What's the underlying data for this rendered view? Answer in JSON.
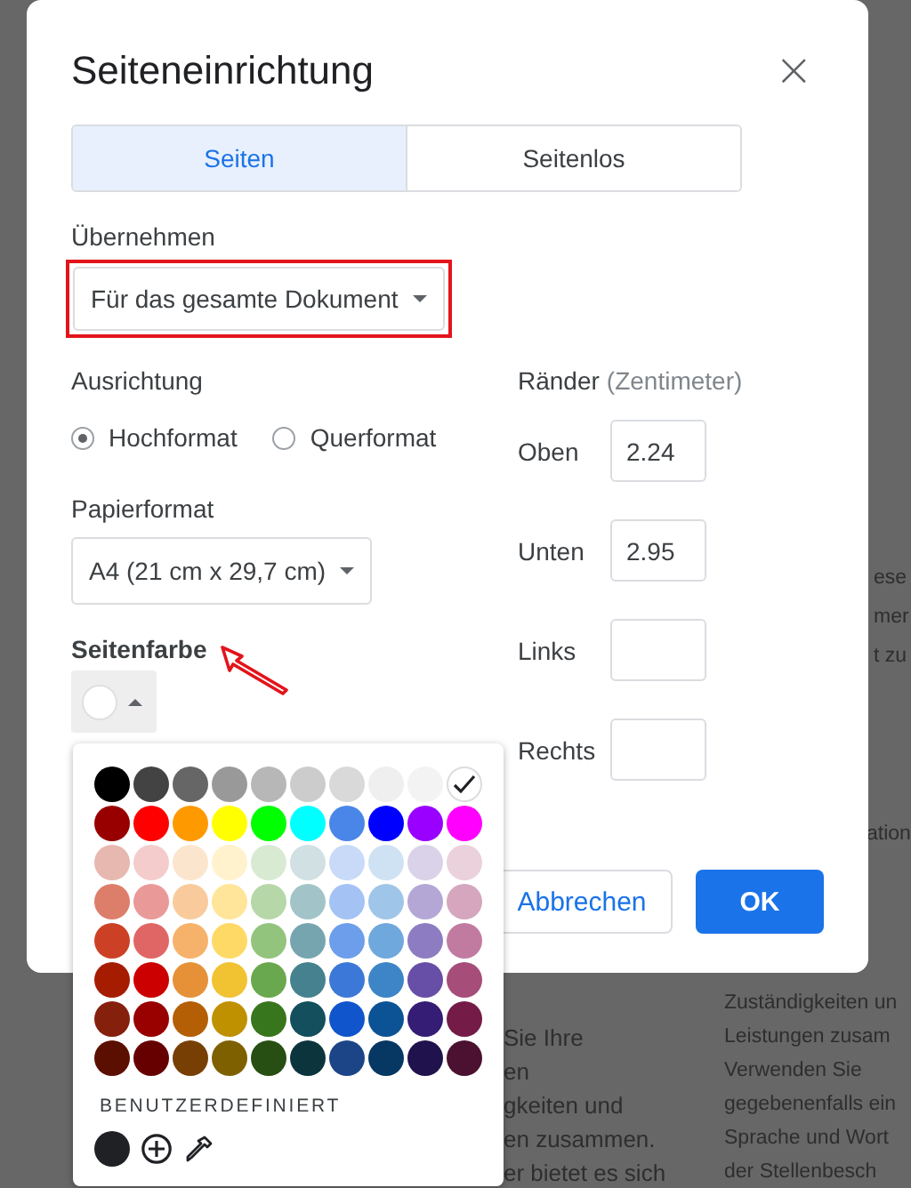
{
  "background_document": {
    "right_column": [
      "ese",
      "mer",
      "t zu",
      "ation",
      "Zuständigkeiten un",
      "Leistungen zusam",
      "Verwenden Sie",
      "gegebenenfalls ein",
      "Sprache und Wort",
      "der Stellenbesch"
    ],
    "middle_column": [
      "Sie Ihre",
      "en",
      "gkeiten und",
      "en zusammen.",
      "er bietet es sich"
    ]
  },
  "dialog": {
    "title": "Seiteneinrichtung",
    "close": "×",
    "tabs": [
      {
        "label": "Seiten",
        "selected": true
      },
      {
        "label": "Seitenlos",
        "selected": false
      }
    ],
    "apply": {
      "label": "Übernehmen",
      "value": "Für das gesamte Dokument"
    },
    "orientation": {
      "label": "Ausrichtung",
      "options": [
        {
          "label": "Hochformat",
          "selected": true
        },
        {
          "label": "Querformat",
          "selected": false
        }
      ]
    },
    "paper_size": {
      "label": "Papierformat",
      "value": "A4 (21 cm x 29,7 cm)"
    },
    "page_color": {
      "label": "Seitenfarbe",
      "color": "#ffffff"
    },
    "margins": {
      "label": "Ränder",
      "unit": "(Zentimeter)",
      "fields": [
        {
          "label": "Oben",
          "value": "2.24"
        },
        {
          "label": "Unten",
          "value": "2.95"
        },
        {
          "label": "Links"
        },
        {
          "label": "Rechts"
        }
      ]
    },
    "buttons": [
      {
        "label": "Abbrechen",
        "kind": "secondary"
      },
      {
        "label": "OK",
        "kind": "primary"
      }
    ]
  },
  "palette": {
    "swatches": [
      {
        "color": "#000000",
        "selected": false
      },
      {
        "color": "#434343",
        "selected": false
      },
      {
        "color": "#666666",
        "selected": false
      },
      {
        "color": "#999999",
        "selected": false
      },
      {
        "color": "#b7b7b7",
        "selected": false
      },
      {
        "color": "#cccccc",
        "selected": false
      },
      {
        "color": "#d9d9d9",
        "selected": false
      },
      {
        "color": "#efefef",
        "selected": false
      },
      {
        "color": "#f3f3f3",
        "selected": false
      },
      {
        "color": "#ffffff",
        "selected": true
      },
      {
        "color": "#980000",
        "selected": false
      },
      {
        "color": "#ff0000",
        "selected": false
      },
      {
        "color": "#ff9900",
        "selected": false
      },
      {
        "color": "#ffff00",
        "selected": false
      },
      {
        "color": "#00ff00",
        "selected": false
      },
      {
        "color": "#00ffff",
        "selected": false
      },
      {
        "color": "#4a86e8",
        "selected": false
      },
      {
        "color": "#0000ff",
        "selected": false
      },
      {
        "color": "#9900ff",
        "selected": false
      },
      {
        "color": "#ff00ff",
        "selected": false
      },
      {
        "color": "#e6b8af",
        "selected": false
      },
      {
        "color": "#f4cccc",
        "selected": false
      },
      {
        "color": "#fce5cd",
        "selected": false
      },
      {
        "color": "#fff2cc",
        "selected": false
      },
      {
        "color": "#d9ead3",
        "selected": false
      },
      {
        "color": "#d0e0e3",
        "selected": false
      },
      {
        "color": "#c9daf8",
        "selected": false
      },
      {
        "color": "#cfe2f3",
        "selected": false
      },
      {
        "color": "#d9d2e9",
        "selected": false
      },
      {
        "color": "#ead1dc",
        "selected": false
      },
      {
        "color": "#dd7e6b",
        "selected": false
      },
      {
        "color": "#ea9999",
        "selected": false
      },
      {
        "color": "#f9cb9c",
        "selected": false
      },
      {
        "color": "#ffe599",
        "selected": false
      },
      {
        "color": "#b6d7a8",
        "selected": false
      },
      {
        "color": "#a2c4c9",
        "selected": false
      },
      {
        "color": "#a4c2f4",
        "selected": false
      },
      {
        "color": "#9fc5e8",
        "selected": false
      },
      {
        "color": "#b4a7d6",
        "selected": false
      },
      {
        "color": "#d5a6bd",
        "selected": false
      },
      {
        "color": "#cc4125",
        "selected": false
      },
      {
        "color": "#e06666",
        "selected": false
      },
      {
        "color": "#f6b26b",
        "selected": false
      },
      {
        "color": "#ffd966",
        "selected": false
      },
      {
        "color": "#93c47d",
        "selected": false
      },
      {
        "color": "#76a5af",
        "selected": false
      },
      {
        "color": "#6d9eeb",
        "selected": false
      },
      {
        "color": "#6fa8dc",
        "selected": false
      },
      {
        "color": "#8e7cc3",
        "selected": false
      },
      {
        "color": "#c27ba0",
        "selected": false
      },
      {
        "color": "#a61c00",
        "selected": false
      },
      {
        "color": "#cc0000",
        "selected": false
      },
      {
        "color": "#e69138",
        "selected": false
      },
      {
        "color": "#f1c232",
        "selected": false
      },
      {
        "color": "#6aa84f",
        "selected": false
      },
      {
        "color": "#45818e",
        "selected": false
      },
      {
        "color": "#3c78d8",
        "selected": false
      },
      {
        "color": "#3d85c6",
        "selected": false
      },
      {
        "color": "#674ea7",
        "selected": false
      },
      {
        "color": "#a64d79",
        "selected": false
      },
      {
        "color": "#85200c",
        "selected": false
      },
      {
        "color": "#990000",
        "selected": false
      },
      {
        "color": "#b45f06",
        "selected": false
      },
      {
        "color": "#bf9000",
        "selected": false
      },
      {
        "color": "#38761d",
        "selected": false
      },
      {
        "color": "#134f5c",
        "selected": false
      },
      {
        "color": "#1155cc",
        "selected": false
      },
      {
        "color": "#0b5394",
        "selected": false
      },
      {
        "color": "#351c75",
        "selected": false
      },
      {
        "color": "#741b47",
        "selected": false
      },
      {
        "color": "#5b0f00",
        "selected": false
      },
      {
        "color": "#660000",
        "selected": false
      },
      {
        "color": "#783f04",
        "selected": false
      },
      {
        "color": "#7f6000",
        "selected": false
      },
      {
        "color": "#274e13",
        "selected": false
      },
      {
        "color": "#0c343d",
        "selected": false
      },
      {
        "color": "#1c4587",
        "selected": false
      },
      {
        "color": "#073763",
        "selected": false
      },
      {
        "color": "#20124d",
        "selected": false
      },
      {
        "color": "#4c1130",
        "selected": false
      }
    ],
    "custom_label": "BENUTZERDEFINIERT",
    "custom_colors": [
      {
        "color": "#202124"
      }
    ]
  }
}
